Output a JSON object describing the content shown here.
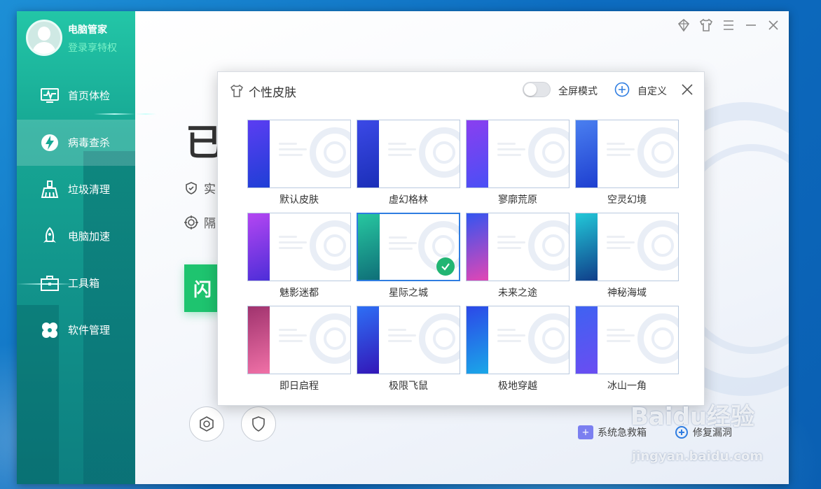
{
  "sidebar": {
    "user_name": "电脑管家",
    "login_link": "登录享特权",
    "items": [
      {
        "label": "首页体检",
        "icon": "monitor-pulse-icon"
      },
      {
        "label": "病毒查杀",
        "icon": "lightning-shield-icon"
      },
      {
        "label": "垃圾清理",
        "icon": "broom-icon"
      },
      {
        "label": "电脑加速",
        "icon": "rocket-icon"
      },
      {
        "label": "工具箱",
        "icon": "toolbox-icon"
      },
      {
        "label": "软件管理",
        "icon": "clover-icon"
      }
    ],
    "active_index": 1
  },
  "main": {
    "status_glyph": "已",
    "line1_glyph": "实",
    "line2_glyph": "隔",
    "green_button_glyph": "闪",
    "bottom_links": [
      {
        "label": "系统急救箱",
        "icon": "first-aid-kit-icon"
      },
      {
        "label": "修复漏洞",
        "icon": "patch-icon"
      }
    ]
  },
  "window_controls": [
    "gem-icon",
    "skin-shirt-icon",
    "menu-icon",
    "minimize-icon",
    "close-icon"
  ],
  "dialog": {
    "title": "个性皮肤",
    "fullscreen_label": "全屏模式",
    "fullscreen_on": false,
    "custom_label": "自定义",
    "skins": [
      {
        "name": "默认皮肤",
        "colors": [
          "#5b3df2",
          "#1f3fd6"
        ],
        "selected": false
      },
      {
        "name": "虚幻格林",
        "colors": [
          "#3b49e6",
          "#1b2fb8"
        ],
        "selected": false
      },
      {
        "name": "寥廓荒原",
        "colors": [
          "#8a3ff0",
          "#4a4ff5"
        ],
        "selected": false
      },
      {
        "name": "空灵幻境",
        "colors": [
          "#4a7ff0",
          "#1e3fd0"
        ],
        "selected": false
      },
      {
        "name": "魅影迷都",
        "colors": [
          "#b446f2",
          "#4d2ed8"
        ],
        "selected": false
      },
      {
        "name": "星际之城",
        "colors": [
          "#27c7a0",
          "#0f6f78"
        ],
        "selected": true
      },
      {
        "name": "未来之途",
        "colors": [
          "#3355f0",
          "#e246b4"
        ],
        "selected": false
      },
      {
        "name": "神秘海域",
        "colors": [
          "#22c8d8",
          "#103e8a"
        ],
        "selected": false
      },
      {
        "name": "即日启程",
        "colors": [
          "#a0336e",
          "#f071a7"
        ],
        "selected": false
      },
      {
        "name": "极限飞鼠",
        "colors": [
          "#2e6ff5",
          "#3317b8"
        ],
        "selected": false
      },
      {
        "name": "极地穿越",
        "colors": [
          "#2c48e8",
          "#1aa7e8"
        ],
        "selected": false
      },
      {
        "name": "冰山一角",
        "colors": [
          "#3f62f2",
          "#6a4df2"
        ],
        "selected": false
      }
    ]
  },
  "watermark": {
    "line1": "Baidu经验",
    "line2": "jingyan.baidu.com"
  }
}
